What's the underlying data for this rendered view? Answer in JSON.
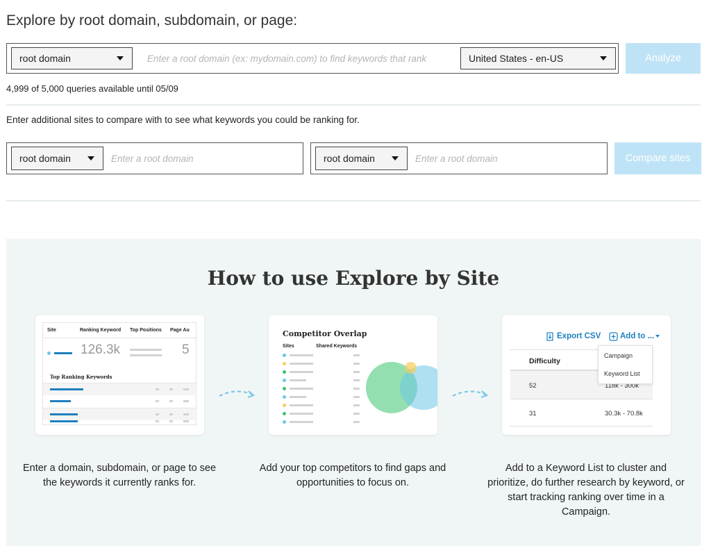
{
  "header": {
    "title": "Explore by root domain, subdomain, or page:"
  },
  "search": {
    "type_value": "root domain",
    "placeholder": "Enter a root domain (ex: mydomain.com) to find keywords that rank",
    "locale_value": "United States - en-US",
    "analyze_label": "Analyze"
  },
  "quota": {
    "text": "4,999 of 5,000 queries available until 05/09"
  },
  "compare": {
    "description": "Enter additional sites to compare with to see what keywords you could be ranking for.",
    "site1": {
      "type_value": "root domain",
      "placeholder": "Enter a root domain"
    },
    "site2": {
      "type_value": "root domain",
      "placeholder": "Enter a root domain"
    },
    "button_label": "Compare sites"
  },
  "how_to": {
    "title": "How to use Explore by Site",
    "cards": [
      {
        "caption": "Enter a domain, subdomain, or page to see the keywords it currently ranks for.",
        "columns": [
          "Site",
          "Ranking Keyword",
          "Top Positions",
          "Page Au"
        ],
        "big_value": "126.3k",
        "big_value_2": "5",
        "subtitle": "Top Ranking Keywords"
      },
      {
        "caption": "Add your top competitors to find gaps and opportunities to focus on.",
        "title": "Competitor Overlap",
        "columns": [
          "Sites",
          "Shared Keywords"
        ]
      },
      {
        "caption": "Add to a Keyword List to cluster and prioritize, do further research by keyword, or start tracking ranking over time in a Campaign.",
        "export_label": "Export CSV",
        "add_label": "Add to ...",
        "column": "Difficulty",
        "menu": [
          "Campaign",
          "Keyword List"
        ],
        "rows": [
          {
            "difficulty": "52",
            "volume": "118k - 300k"
          },
          {
            "difficulty": "31",
            "volume": "30.3k - 70.8k"
          }
        ]
      }
    ]
  },
  "colors": {
    "button_bg": "#bfe3f6",
    "panel_bg": "#f0f5f5",
    "accent": "#1d7fbf"
  },
  "icons": [
    "caret-down-icon",
    "dashed-arrow-icon",
    "export-icon",
    "plus-square-icon"
  ]
}
